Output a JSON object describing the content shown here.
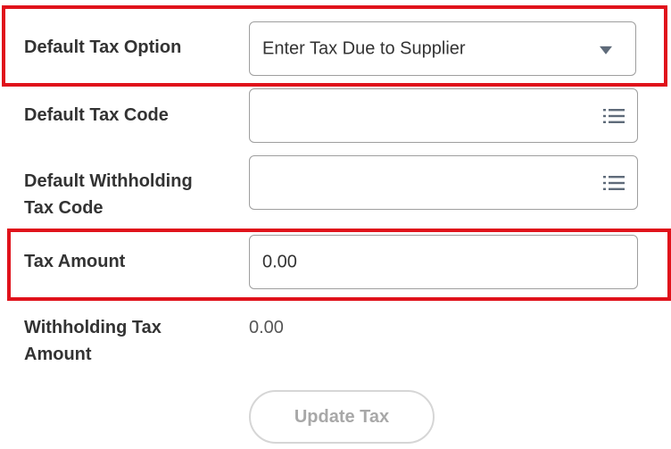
{
  "fields": {
    "default_tax_option": {
      "label": "Default Tax Option",
      "value": "Enter Tax Due to Supplier"
    },
    "default_tax_code": {
      "label": "Default Tax Code",
      "value": ""
    },
    "default_withholding_tax_code": {
      "label_line1": "Default Withholding",
      "label_line2": "Tax Code",
      "value": ""
    },
    "tax_amount": {
      "label": "Tax Amount",
      "value": "0.00"
    },
    "withholding_tax_amount": {
      "label_line1": "Withholding Tax",
      "label_line2": "Amount",
      "value": "0.00"
    }
  },
  "update_button": {
    "label": "Update Tax"
  },
  "colors": {
    "highlight": "#e0121b",
    "field_border": "#9e9e9e",
    "label_text": "#333333",
    "disabled_text": "#a8a8a8"
  },
  "icons": {
    "dropdown": "caret-down-icon",
    "prompt": "list-icon"
  }
}
